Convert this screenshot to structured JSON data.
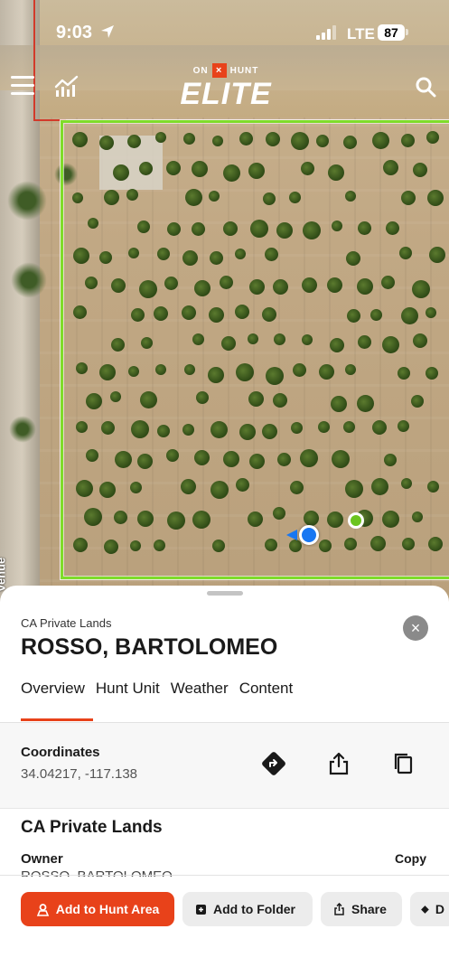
{
  "status_bar": {
    "time": "9:03",
    "network": "LTE",
    "battery": "87"
  },
  "header": {
    "logo_top_left": "ON",
    "logo_x": "×",
    "logo_top_right": "HUNT",
    "logo_main": "ELITE"
  },
  "map": {
    "street_label": "venue",
    "parcel_color": "#7fdc2a",
    "location_color": "#1877f2",
    "waypoint_color": "#6cc41e"
  },
  "sheet": {
    "subtitle": "CA Private Lands",
    "title": "ROSSO, BARTOLOMEO",
    "close_icon": "×",
    "tabs": [
      {
        "label": "Overview",
        "active": true
      },
      {
        "label": "Hunt Unit"
      },
      {
        "label": "Weather"
      },
      {
        "label": "Content"
      }
    ],
    "coordinates": {
      "label": "Coordinates",
      "value": "34.04217, -117.138"
    },
    "lands": {
      "heading": "CA Private Lands",
      "owner_label": "Owner",
      "owner_value": "ROSSO, BARTOLOMEO",
      "copy_label": "Copy"
    },
    "actions": {
      "add_hunt_area": "Add to Hunt Area",
      "add_folder": "Add to Folder",
      "share": "Share",
      "directions": "D"
    },
    "accent_color": "#e8421a"
  }
}
